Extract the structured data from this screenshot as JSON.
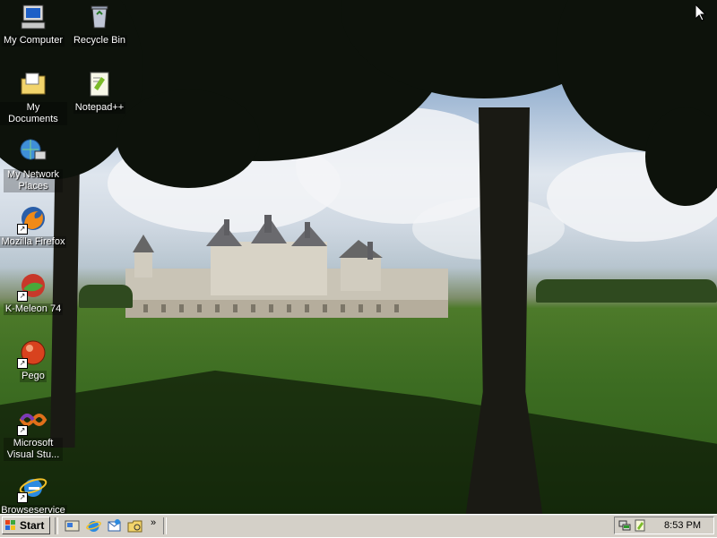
{
  "desktop": {
    "icons": [
      {
        "label": "My Computer",
        "icon": "computer-icon",
        "shortcut": false
      },
      {
        "label": "Recycle Bin",
        "icon": "recycle-bin-icon",
        "shortcut": false
      },
      {
        "label": "My Documents",
        "icon": "folder-icon",
        "shortcut": false
      },
      {
        "label": "Notepad++",
        "icon": "notepad-plus-icon",
        "shortcut": false
      },
      {
        "label": "My Network Places",
        "icon": "network-icon",
        "shortcut": false
      },
      {
        "label": "Mozilla Firefox",
        "icon": "firefox-icon",
        "shortcut": true
      },
      {
        "label": "K-Meleon 74",
        "icon": "k-meleon-icon",
        "shortcut": true
      },
      {
        "label": "Pego",
        "icon": "pego-icon",
        "shortcut": true
      },
      {
        "label": "Microsoft Visual Stu...",
        "icon": "visual-studio-icon",
        "shortcut": true
      },
      {
        "label": "Browseservice",
        "icon": "internet-explorer-icon",
        "shortcut": true
      }
    ]
  },
  "taskbar": {
    "start_label": "Start",
    "quick_launch": [
      "show-desktop-icon",
      "internet-explorer-icon",
      "outlook-express-icon",
      "windows-explorer-icon"
    ],
    "chevron": "»",
    "clock": "8:53 PM",
    "tray_icons": [
      "network-tray-icon",
      "notepad-tray-icon"
    ]
  },
  "colors": {
    "taskbar_bg": "#d4d0c8",
    "icon_label_text": "#ffffff"
  }
}
